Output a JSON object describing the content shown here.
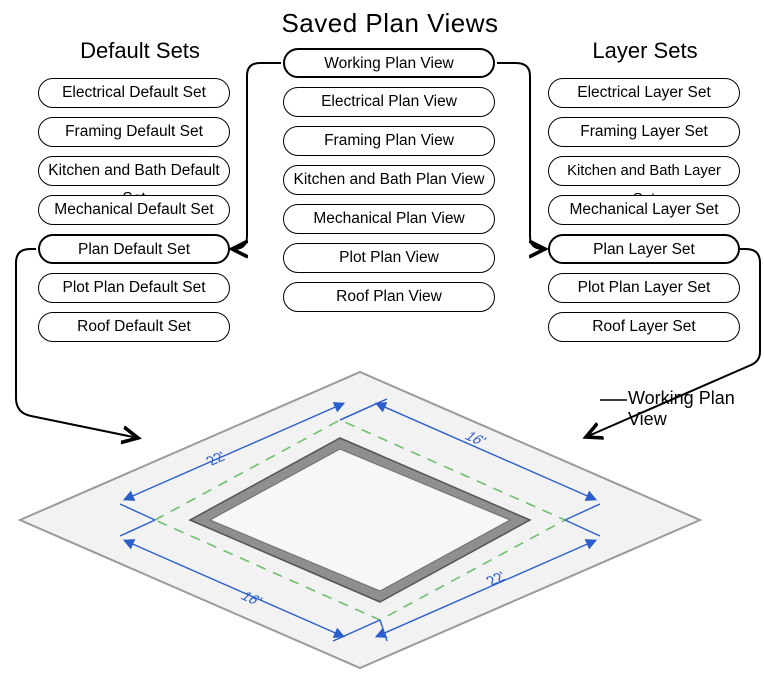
{
  "titles": {
    "main": "Saved Plan Views",
    "left": "Default Sets",
    "right": "Layer Sets"
  },
  "columns": {
    "left": {
      "items": [
        "Electrical Default Set",
        "Framing Default Set",
        "Kitchen and Bath Default Set",
        "Mechanical Default Set",
        "Plan Default Set",
        "Plot Plan Default Set",
        "Roof Default Set"
      ],
      "bold_index": 4
    },
    "center": {
      "items": [
        "Working Plan View",
        "Electrical Plan View",
        "Framing Plan View",
        "Kitchen and Bath Plan View",
        "Mechanical Plan View",
        "Plot Plan View",
        "Roof Plan View"
      ],
      "bold_index": 0
    },
    "right": {
      "items": [
        "Electrical Layer Set",
        "Framing Layer Set",
        "Kitchen and Bath Layer Set",
        "Mechanical Layer Set",
        "Plan Layer Set",
        "Plot Plan Layer Set",
        "Roof Layer Set"
      ],
      "bold_index": 4
    }
  },
  "diagram": {
    "caption": "Working Plan View",
    "dimensions": {
      "short_side": "16'",
      "long_side": "22'"
    },
    "colors": {
      "sheet_fill": "#f2f2f2",
      "sheet_edge": "#9a9a9a",
      "wall_fill": "#8f8f8f",
      "wall_edge": "#555555",
      "roof_dash": "#6fbf6f",
      "dim_line": "#2b5ecb"
    }
  }
}
